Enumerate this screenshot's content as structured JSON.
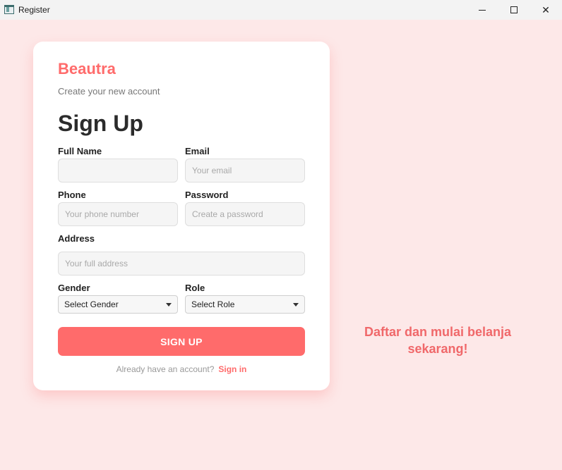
{
  "window": {
    "title": "Register",
    "minimize": "minimize-icon",
    "maximize": "maximize-icon",
    "close": "✕"
  },
  "brand": {
    "name": "Beautra",
    "color": "#ff6b6b"
  },
  "form": {
    "subtitle": "Create your new account",
    "heading": "Sign Up",
    "full_name": {
      "label": "Full Name",
      "value": "",
      "placeholder": ""
    },
    "email": {
      "label": "Email",
      "value": "",
      "placeholder": "Your email"
    },
    "phone": {
      "label": "Phone",
      "value": "",
      "placeholder": "Your phone number"
    },
    "password": {
      "label": "Password",
      "value": "",
      "placeholder": "Create a password"
    },
    "address": {
      "label": "Address",
      "value": "",
      "placeholder": "Your full address"
    },
    "gender": {
      "label": "Gender",
      "selected": "Select Gender"
    },
    "role": {
      "label": "Role",
      "selected": "Select Role"
    },
    "submit_label": "SIGN UP",
    "footer_text": "Already have an account?",
    "signin_link": "Sign in"
  },
  "promo": {
    "line1": "Daftar dan mulai belanja",
    "line2": "sekarang!"
  },
  "colors": {
    "background": "#fde8e8",
    "accent": "#ff6b6b",
    "card": "#ffffff"
  }
}
